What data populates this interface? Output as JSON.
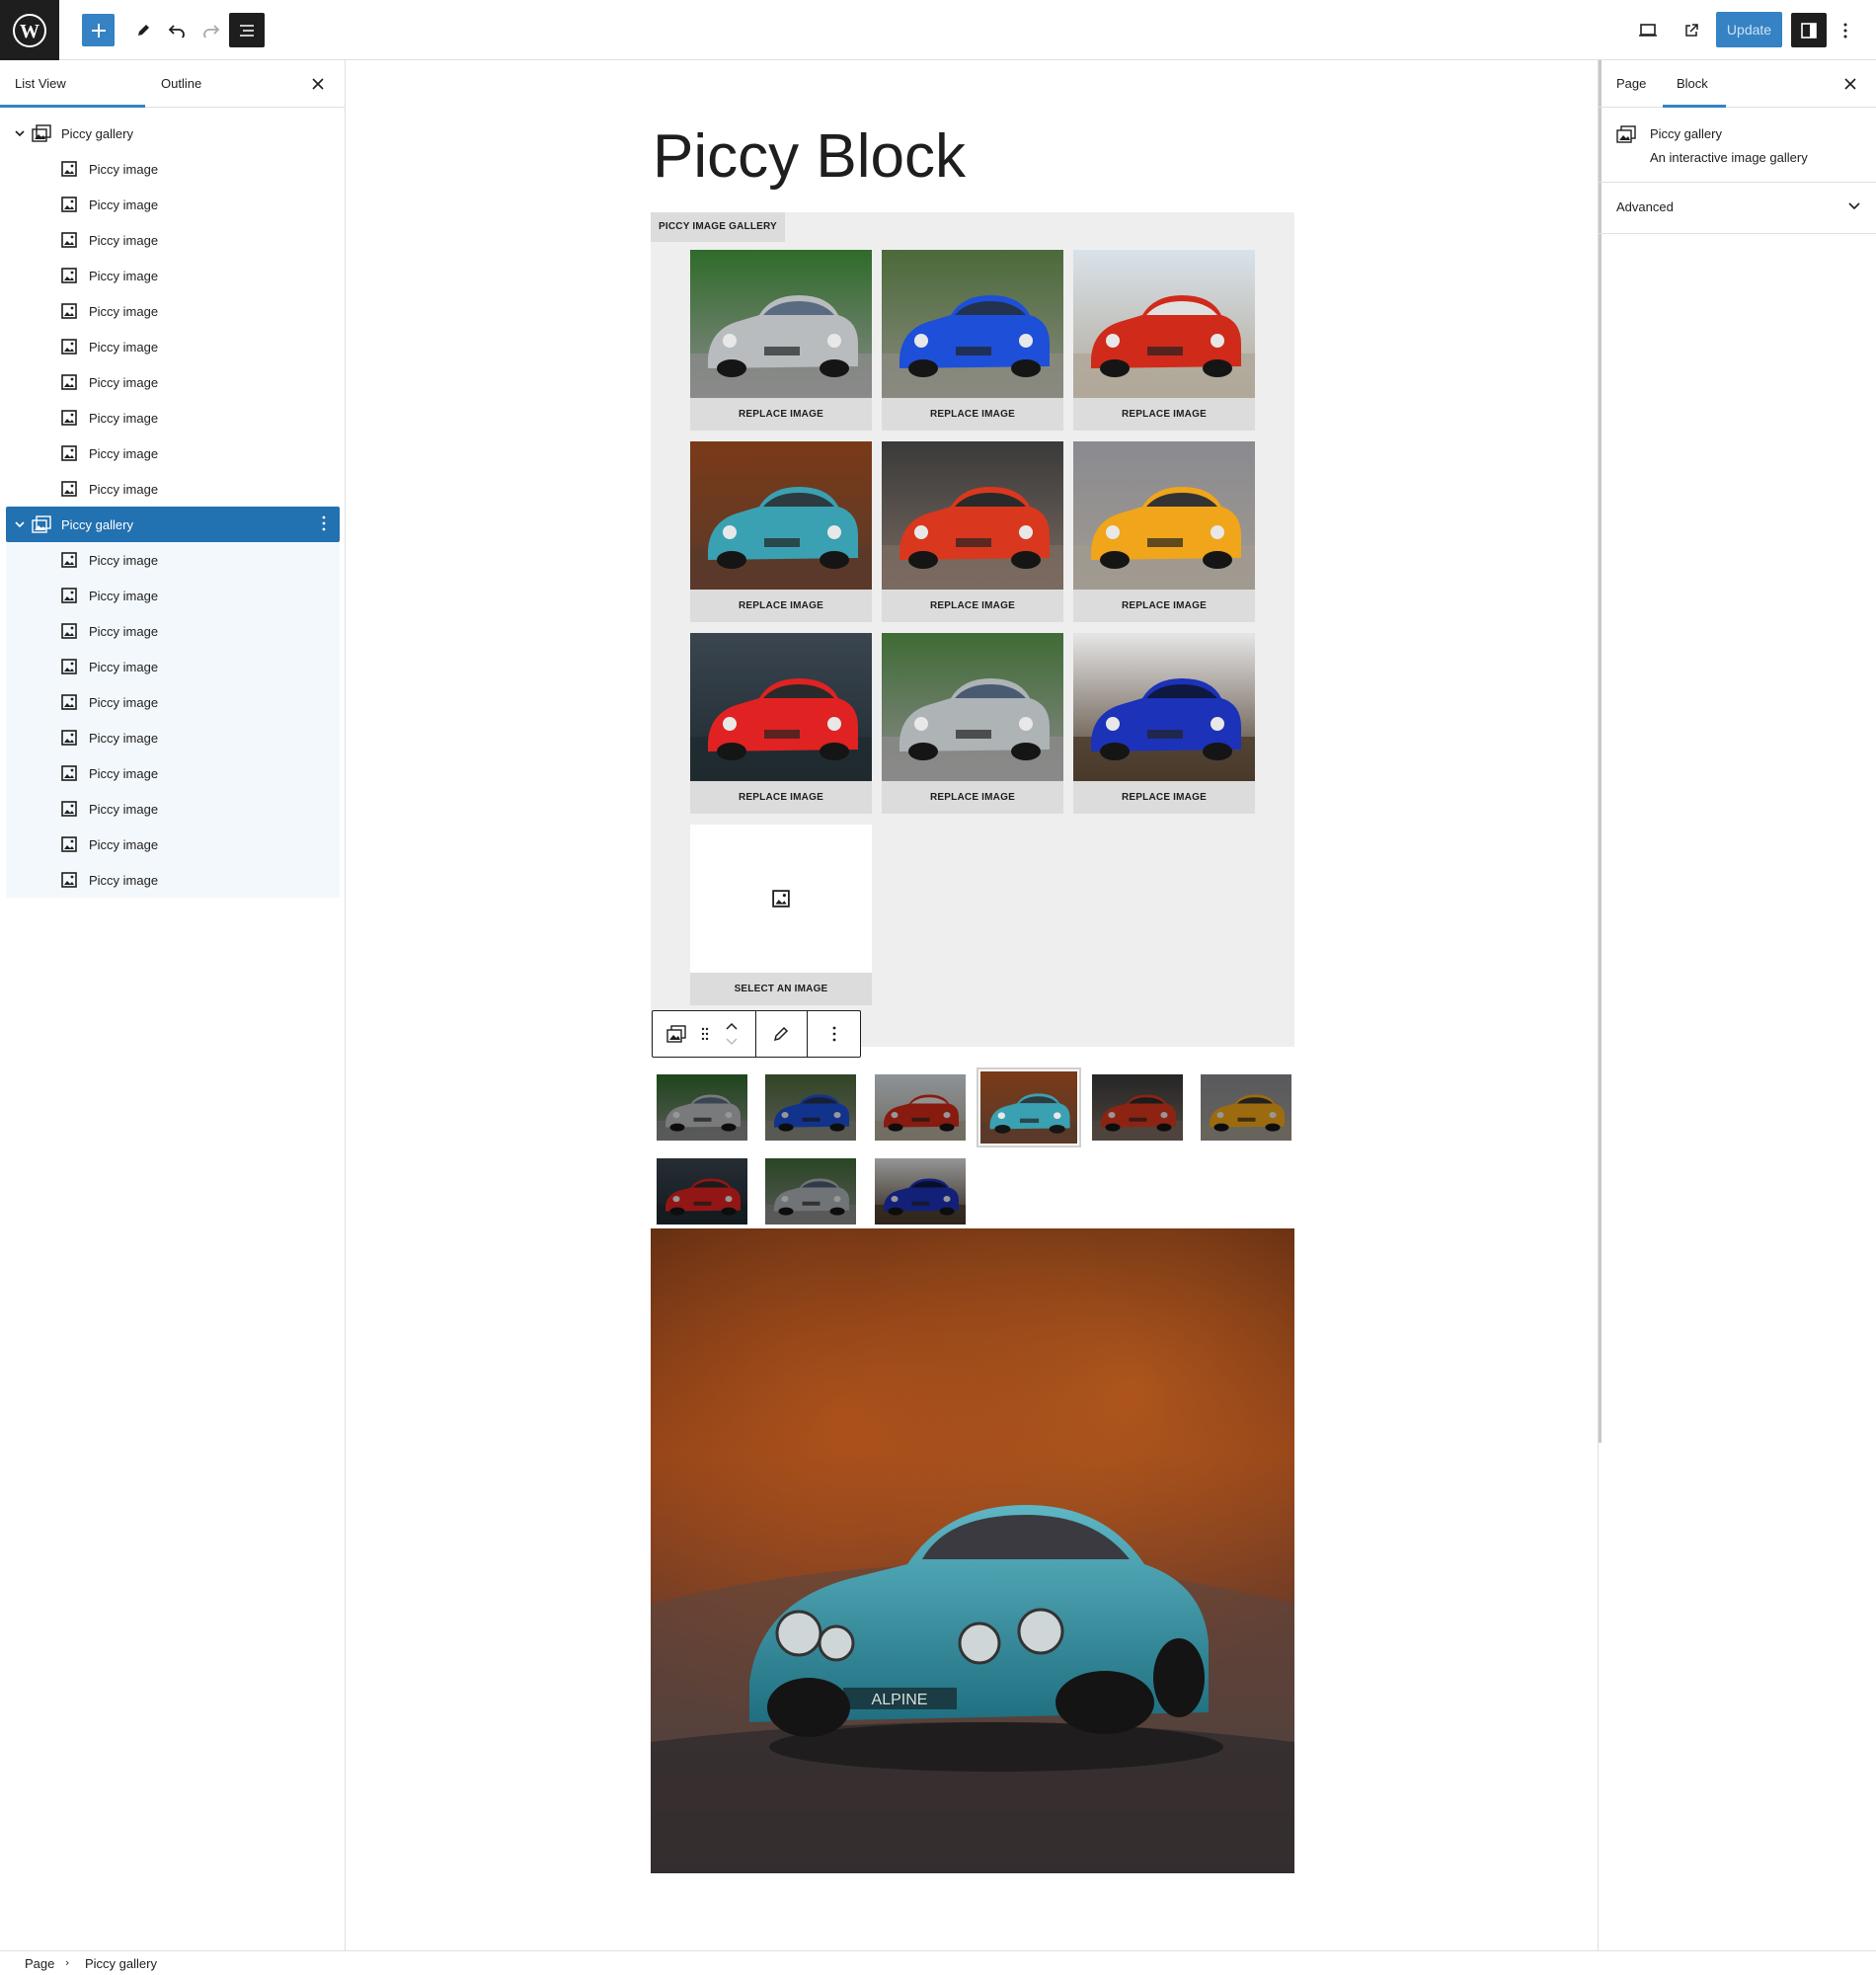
{
  "topbar": {
    "update_label": "Update",
    "icons": [
      "wordpress-logo-icon",
      "plus-icon",
      "pencil-icon",
      "undo-icon",
      "redo-icon",
      "list-view-icon",
      "desktop-view-icon",
      "external-link-icon",
      "settings-panel-icon",
      "more-options-icon"
    ]
  },
  "left_panel": {
    "tabs": [
      "List View",
      "Outline"
    ],
    "active_tab": "List View",
    "gallery_label": "Piccy gallery",
    "image_label": "Piccy image",
    "galleries": [
      {
        "label": "Piccy gallery",
        "expanded": true,
        "selected": false,
        "images": [
          "Piccy image",
          "Piccy image",
          "Piccy image",
          "Piccy image",
          "Piccy image",
          "Piccy image",
          "Piccy image",
          "Piccy image",
          "Piccy image",
          "Piccy image"
        ]
      },
      {
        "label": "Piccy gallery",
        "expanded": true,
        "selected": true,
        "images": [
          "Piccy image",
          "Piccy image",
          "Piccy image",
          "Piccy image",
          "Piccy image",
          "Piccy image",
          "Piccy image",
          "Piccy image",
          "Piccy image",
          "Piccy image"
        ]
      }
    ]
  },
  "right_panel": {
    "tabs": [
      "Page",
      "Block"
    ],
    "active_tab": "Block",
    "block_name": "Piccy gallery",
    "block_description": "An interactive image gallery",
    "advanced_label": "Advanced"
  },
  "canvas": {
    "title": "Piccy Block",
    "gallery_label": "PICCY IMAGE GALLERY",
    "replace_label": "REPLACE IMAGE",
    "select_label": "SELECT AN IMAGE",
    "tiles": [
      {
        "subject": "silver sports coupe",
        "action": "REPLACE IMAGE"
      },
      {
        "subject": "blue sedan",
        "action": "REPLACE IMAGE"
      },
      {
        "subject": "red classic car",
        "action": "REPLACE IMAGE"
      },
      {
        "subject": "teal vintage coupe",
        "action": "REPLACE IMAGE"
      },
      {
        "subject": "red supercar",
        "action": "REPLACE IMAGE"
      },
      {
        "subject": "yellow supercar",
        "action": "REPLACE IMAGE"
      },
      {
        "subject": "red roadster",
        "action": "REPLACE IMAGE"
      },
      {
        "subject": "silver sports coupe",
        "action": "REPLACE IMAGE"
      },
      {
        "subject": "blue sedan",
        "action": "REPLACE IMAGE"
      },
      {
        "subject": "empty",
        "action": "SELECT AN IMAGE"
      }
    ],
    "thumbnails_count": 9,
    "active_thumbnail": 4
  },
  "colors": {
    "accent": "#3582c4",
    "selected": "#2271b1",
    "dark": "#1e1e1e"
  },
  "breadcrumb": [
    "Page",
    "Piccy gallery"
  ]
}
